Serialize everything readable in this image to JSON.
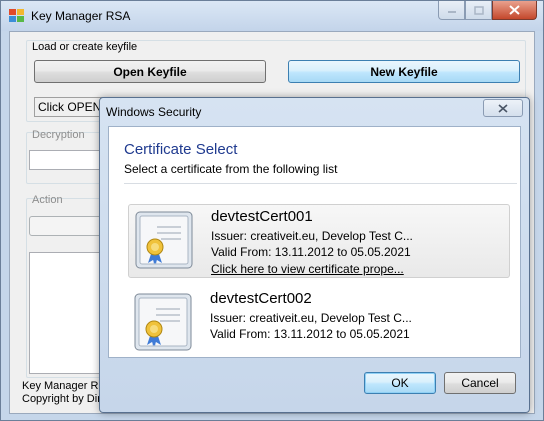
{
  "main_window": {
    "title": "Key Manager RSA",
    "load_group_label": "Load or create keyfile",
    "open_button": "Open Keyfile",
    "new_button": "New Keyfile",
    "status_text": "Click OPEN to",
    "decryption_label": "Decryption",
    "action_label": "Action",
    "footer_line1": "Key Manager RS",
    "footer_line2": "Copyright by Dirk"
  },
  "dialog": {
    "title": "Windows Security",
    "heading": "Certificate Select",
    "subheading": "Select a certificate from the following list",
    "certificates": [
      {
        "name": "devtestCert001",
        "issuer": "Issuer: creativeit.eu, Develop Test C...",
        "valid": "Valid From: 13.11.2012 to 05.05.2021",
        "link": "Click here to view certificate prope...",
        "selected": true
      },
      {
        "name": "devtestCert002",
        "issuer": "Issuer: creativeit.eu, Develop Test C...",
        "valid": "Valid From: 13.11.2012 to 05.05.2021",
        "selected": false
      }
    ],
    "ok_button": "OK",
    "cancel_button": "Cancel"
  },
  "icons": {
    "app": "key-manager-app-icon",
    "certificate": "certificate-ribbon-icon"
  },
  "colors": {
    "heading": "#1f3a8f",
    "link": "#000000",
    "focus_border": "#3c7fb1"
  }
}
